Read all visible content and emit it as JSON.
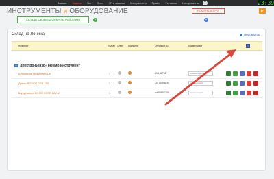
{
  "header": {
    "nav": [
      "Заказы",
      "Задачи",
      "Чат",
      "Фото",
      "ЗП и авансы",
      "Контрагенты",
      "Прайс",
      "Финансы",
      "Инструменты"
    ],
    "active_index": 1,
    "plus": "+",
    "clock": "23:39"
  },
  "page": {
    "title_part1": "ИНСТРУМЕНТЫ ",
    "title_amp": "и",
    "title_part2": " ОБОРУДОВАНИЕ",
    "nomenclature_button": "НОМЕНКЛАТУРА",
    "go_button": "▶",
    "warehouse_button": "Склады Сервисы Объекты Работники",
    "add_green": "+",
    "add_blue": "+"
  },
  "card": {
    "title": "Склад на Ленина",
    "view_link": "Ведомость",
    "columns": [
      "Название",
      "Кол-во",
      "Ответ.",
      "Компания",
      "Серийный №",
      "Комментарий"
    ],
    "group": "Электро-Бензо-Пневмо инструмент",
    "rows": [
      {
        "name": "Бензопила Husqvarna 135",
        "qty": "1",
        "sn": "SN5-11P18",
        "comment": "Комментарий..."
      },
      {
        "name": "Дрель BOSCH GSB 780",
        "qty": "1",
        "sn": "CN 14098678",
        "comment": "Комментарий..."
      },
      {
        "name": "Шуруповерт BOSCH GSR 12V-15",
        "qty": "1",
        "sn": "sn5934907O8",
        "comment": "Комментарий..."
      }
    ]
  },
  "colors": {
    "accent_orange": "#f7931e",
    "danger_red": "#e84a3a",
    "header_bg": "#2b2d2f"
  }
}
